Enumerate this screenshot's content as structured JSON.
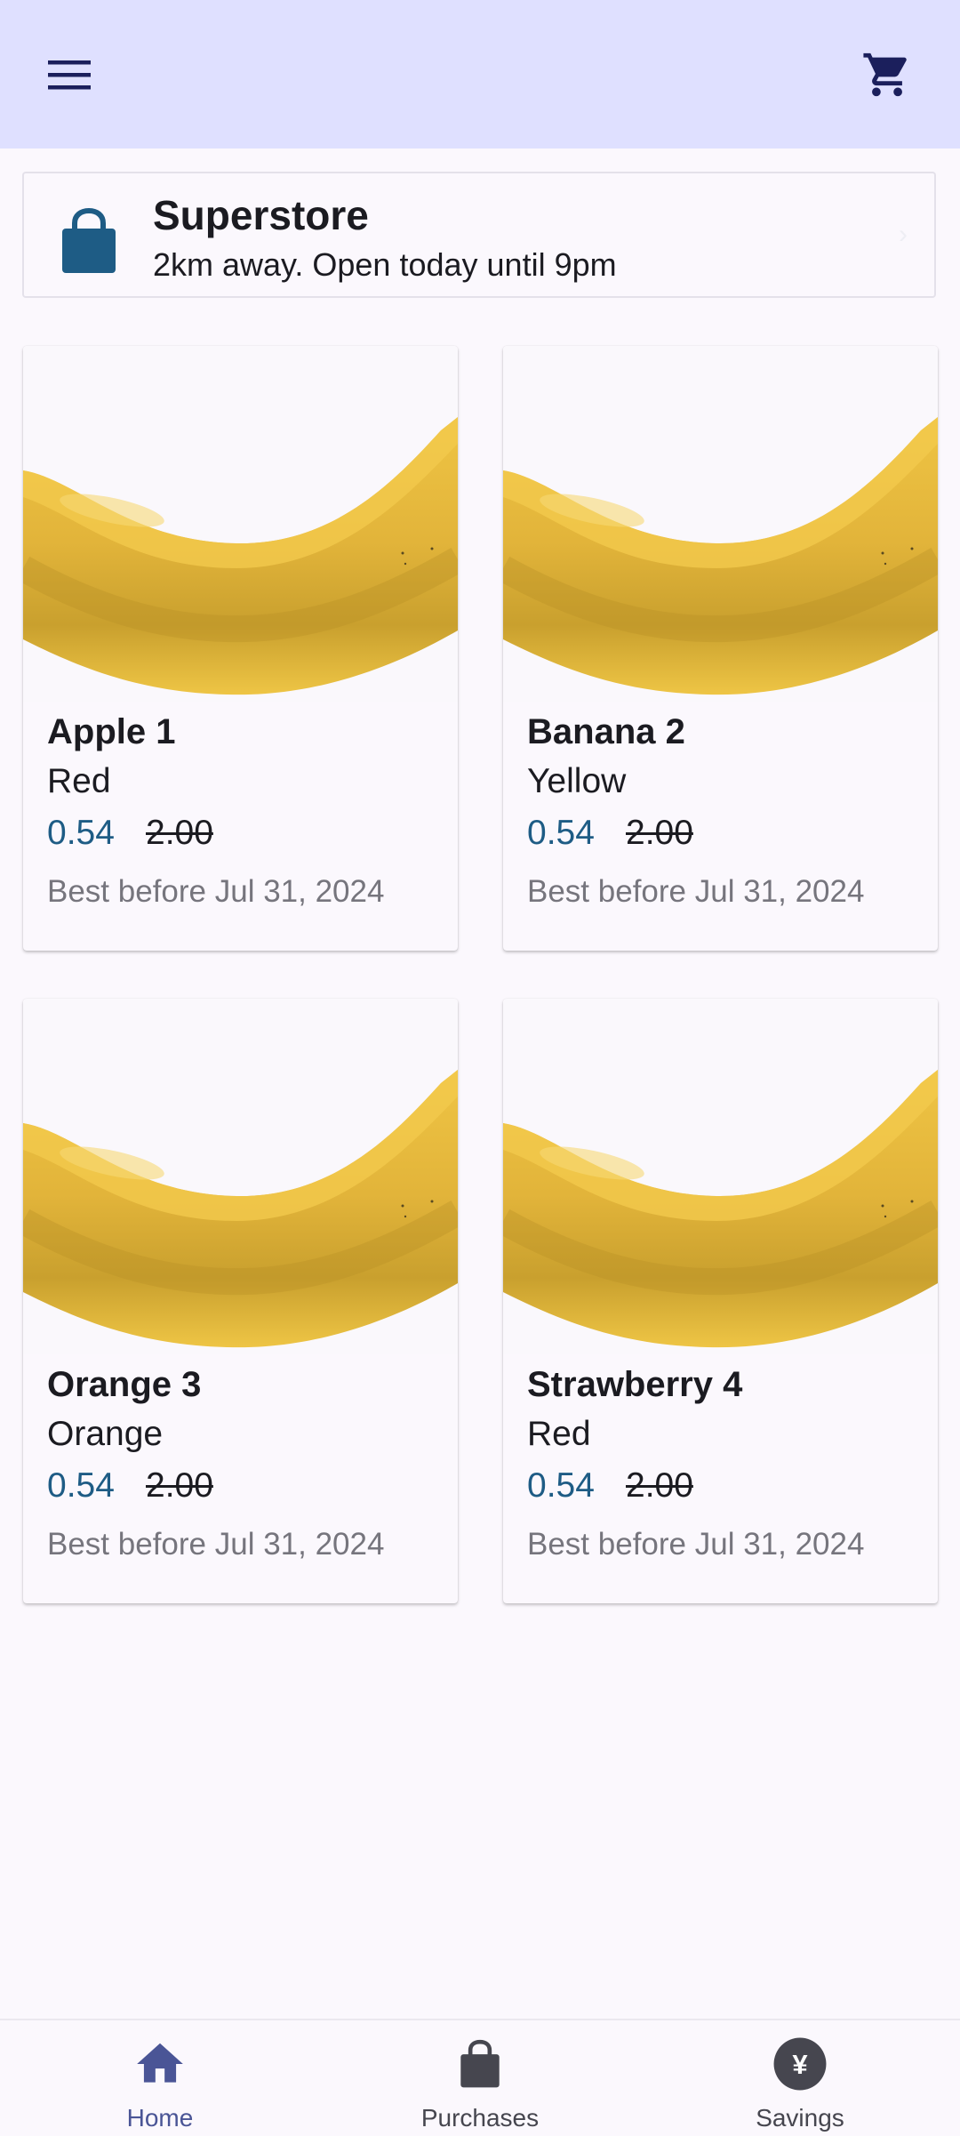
{
  "colors": {
    "top_bar": "#dfe0ff",
    "background": "#fbf8fd",
    "price_accent": "#1e5c85",
    "nav_active": "#4a5596",
    "nav_inactive": "#46464f"
  },
  "topbar": {
    "menu_icon": "hamburger-menu",
    "cart_icon": "shopping-cart"
  },
  "store": {
    "icon": "shopping-bag",
    "name": "Superstore",
    "info": "2km away. Open today until 9pm",
    "chevron": "›"
  },
  "products": [
    {
      "name": "Apple 1",
      "color": "Red",
      "price": "0.54",
      "old_price": "2.00",
      "best_before": "Best before Jul 31, 2024"
    },
    {
      "name": "Banana 2",
      "color": "Yellow",
      "price": "0.54",
      "old_price": "2.00",
      "best_before": "Best before Jul 31, 2024"
    },
    {
      "name": "Orange 3",
      "color": "Orange",
      "price": "0.54",
      "old_price": "2.00",
      "best_before": "Best before Jul 31, 2024"
    },
    {
      "name": "Strawberry 4",
      "color": "Red",
      "price": "0.54",
      "old_price": "2.00",
      "best_before": "Best before Jul 31, 2024"
    }
  ],
  "bottom_nav": {
    "items": [
      {
        "label": "Home",
        "icon": "home",
        "active": true
      },
      {
        "label": "Purchases",
        "icon": "shopping-bag",
        "active": false
      },
      {
        "label": "Savings",
        "icon": "yen-coin",
        "active": false
      }
    ],
    "savings_symbol": "¥"
  }
}
